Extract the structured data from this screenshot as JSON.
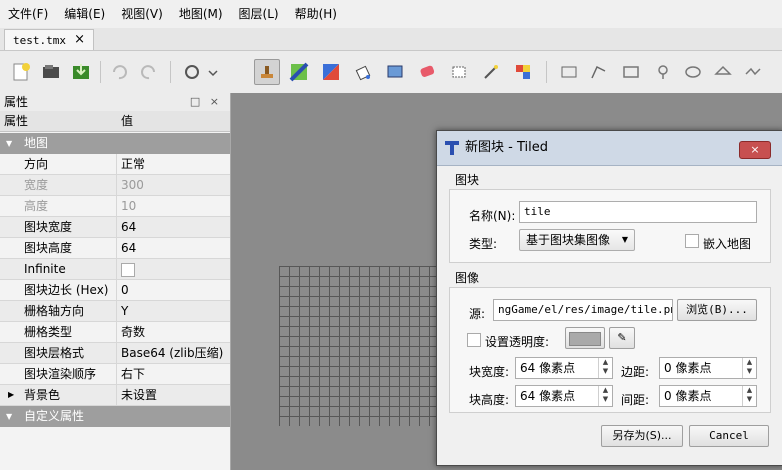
{
  "menu": [
    "文件(F)",
    "编辑(E)",
    "视图(V)",
    "地图(M)",
    "图层(L)",
    "帮助(H)"
  ],
  "tab": {
    "label": "test.tmx",
    "close": "×"
  },
  "toolbar": {
    "icons": [
      "new-map-icon",
      "open-icon",
      "save-icon",
      "undo-icon",
      "redo-icon",
      "commands-icon",
      "stamp-brush-icon",
      "terrain-brush-icon",
      "wang-brush-icon",
      "bucket-fill-icon",
      "shape-fill-icon",
      "eraser-icon",
      "rect-select-icon",
      "magic-wand-icon",
      "select-same-tile-icon",
      "object-select-icon",
      "edit-polygon-icon",
      "insert-rect-icon",
      "insert-point-icon",
      "insert-ellipse-icon",
      "insert-polygon-icon",
      "insert-polyline-icon"
    ]
  },
  "properties": {
    "title": "属性",
    "controls": "□ ×",
    "header_key": "属性",
    "header_value": "值",
    "map_group": "地图",
    "rows": [
      {
        "key": "方向",
        "value": "正常"
      },
      {
        "key": "宽度",
        "value": "300"
      },
      {
        "key": "高度",
        "value": "10"
      },
      {
        "key": "图块宽度",
        "value": "64"
      },
      {
        "key": "图块高度",
        "value": "64"
      },
      {
        "key": "Infinite",
        "value": ""
      },
      {
        "key": "图块边长 (Hex)",
        "value": "0"
      },
      {
        "key": "栅格轴方向",
        "value": "Y"
      },
      {
        "key": "栅格类型",
        "value": "奇数"
      },
      {
        "key": "图块层格式",
        "value": "Base64 (zlib压缩)"
      },
      {
        "key": "图块渲染顺序",
        "value": "右下"
      },
      {
        "key": "背景色",
        "value": "未设置"
      }
    ],
    "custom_group": "自定义属性"
  },
  "dialog": {
    "title": "新图块 - Tiled",
    "close": "×",
    "tileset_section": "图块",
    "name_label": "名称(N):",
    "name_value": "tile",
    "type_label": "类型:",
    "type_value": "基于图块集图像",
    "embed_label": "嵌入地图",
    "image_section": "图像",
    "source_label": "源:",
    "source_value": "ngGame/el/res/image/tile.png",
    "browse_button": "浏览(B)...",
    "transparency_label": "设置透明度:",
    "tile_width_label": "块宽度:",
    "tile_width_value": "64 像素点",
    "margin_label": "边距:",
    "margin_value": "0 像素点",
    "tile_height_label": "块高度:",
    "tile_height_value": "64 像素点",
    "spacing_label": "间距:",
    "spacing_value": "0 像素点",
    "save_as_button": "另存为(S)...",
    "cancel_button": "Cancel"
  },
  "colors": {
    "dialog_titlebar": "#cfd9e6",
    "group_header": "#9e9e9e",
    "canvas": "#8b8b8b",
    "close_button": "#c75050"
  }
}
